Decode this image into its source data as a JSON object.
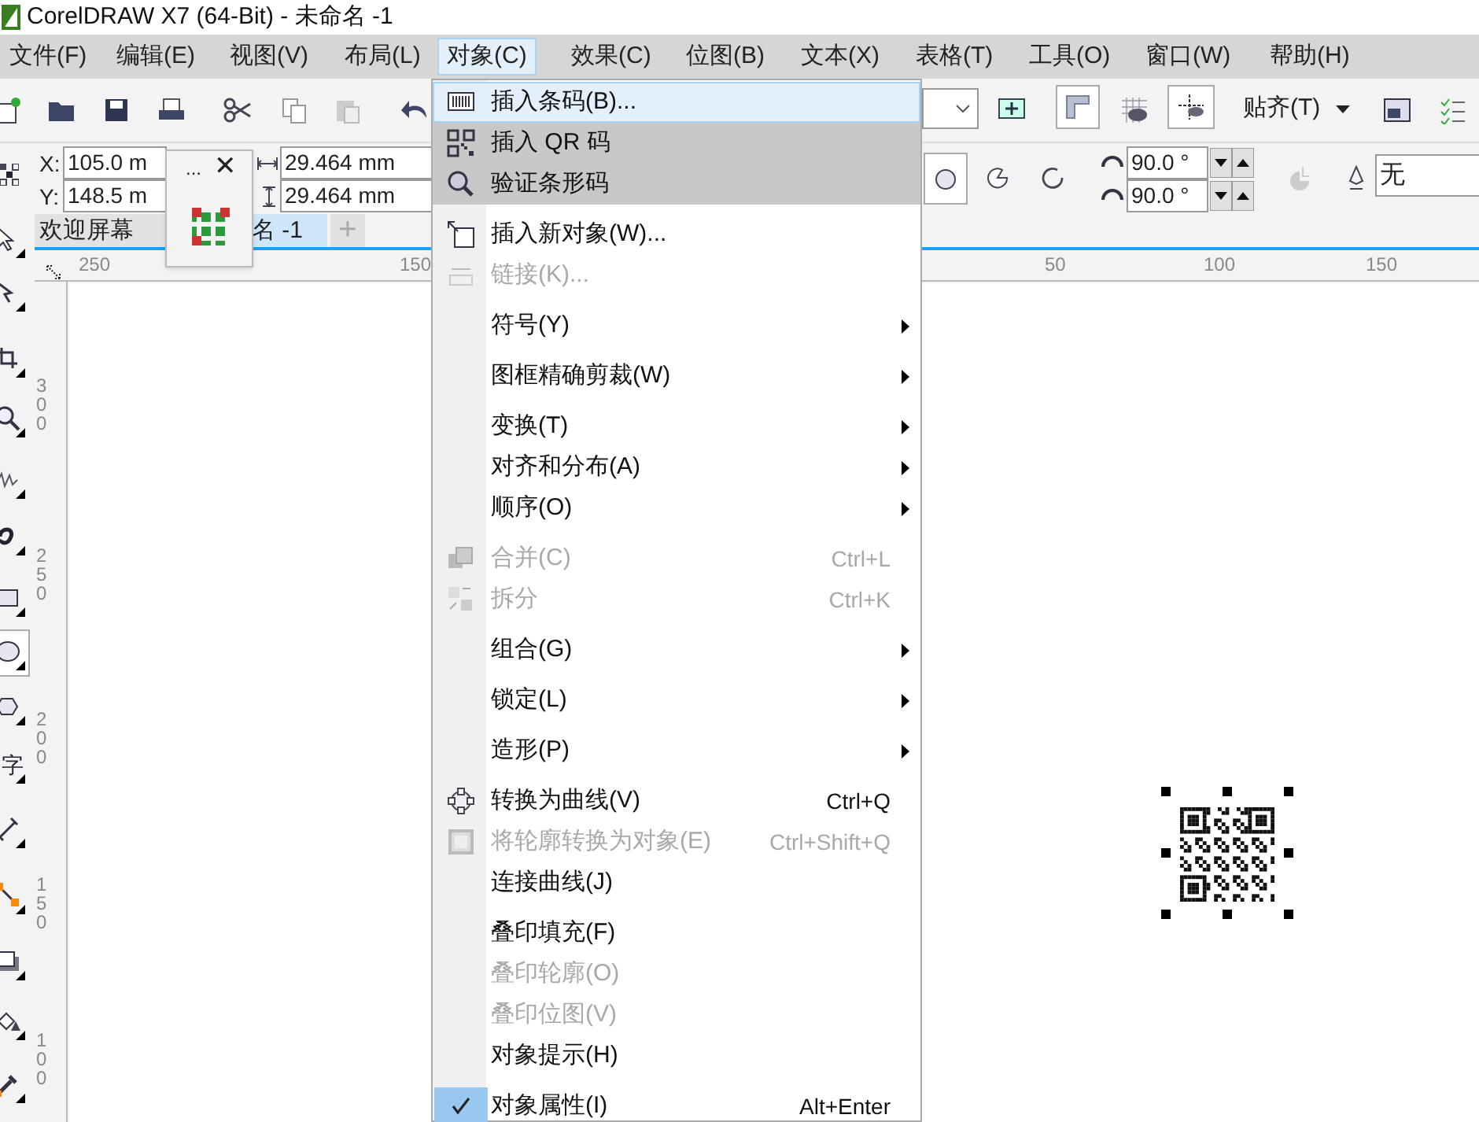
{
  "window": {
    "title": "CorelDRAW X7 (64-Bit) - 未命名 -1"
  },
  "menu_bar": [
    {
      "label": "文件(F)",
      "selected": false
    },
    {
      "label": "编辑(E)",
      "selected": false
    },
    {
      "label": "视图(V)",
      "selected": false
    },
    {
      "label": "布局(L)",
      "selected": false
    },
    {
      "label": "对象(C)",
      "selected": true
    },
    {
      "label": "效果(C)",
      "selected": false
    },
    {
      "label": "位图(B)",
      "selected": false
    },
    {
      "label": "文本(X)",
      "selected": false
    },
    {
      "label": "表格(T)",
      "selected": false
    },
    {
      "label": "工具(O)",
      "selected": false
    },
    {
      "label": "窗口(W)",
      "selected": false
    },
    {
      "label": "帮助(H)",
      "selected": false
    }
  ],
  "toolbar": {
    "snap_label": "贴齐(T)"
  },
  "property_bar": {
    "x_label": "X:",
    "x_value": "105.0 m",
    "y_label": "Y:",
    "y_value": "148.5 m",
    "width": "29.464 mm",
    "height": "29.464 mm",
    "start_angle": "90.0 °",
    "end_angle": "90.0 °",
    "outline": "无"
  },
  "popup": {
    "more": "...",
    "close": "✕"
  },
  "tabs": [
    {
      "label": "欢迎屏幕",
      "selected": false
    },
    {
      "label": "名 -1",
      "selected": true
    }
  ],
  "add_tab": "+",
  "toolbox": {
    "text_tool": "字"
  },
  "rulers": {
    "horizontal": [
      "250",
      "150",
      "50",
      "100",
      "150"
    ],
    "vertical": [
      "300",
      "250",
      "200",
      "150",
      "100"
    ]
  },
  "context_menu": [
    {
      "kind": "item",
      "label": "插入条码(B)...",
      "selected": true,
      "shaded": false,
      "disabled": false,
      "submenu": false
    },
    {
      "kind": "item",
      "label": "插入 QR 码",
      "selected": false,
      "shaded": true,
      "disabled": false,
      "submenu": false
    },
    {
      "kind": "item",
      "label": "验证条形码",
      "selected": false,
      "shaded": true,
      "disabled": false,
      "submenu": false
    },
    {
      "kind": "separator"
    },
    {
      "kind": "item",
      "label": "插入新对象(W)...",
      "selected": false,
      "shaded": false,
      "disabled": false,
      "submenu": false
    },
    {
      "kind": "item",
      "label": "链接(K)...",
      "selected": false,
      "shaded": false,
      "disabled": true,
      "submenu": false
    },
    {
      "kind": "separator"
    },
    {
      "kind": "item",
      "label": "符号(Y)",
      "selected": false,
      "shaded": false,
      "disabled": false,
      "submenu": true
    },
    {
      "kind": "separator"
    },
    {
      "kind": "item",
      "label": "图框精确剪裁(W)",
      "selected": false,
      "shaded": false,
      "disabled": false,
      "submenu": true
    },
    {
      "kind": "separator"
    },
    {
      "kind": "item",
      "label": "变换(T)",
      "selected": false,
      "shaded": false,
      "disabled": false,
      "submenu": true
    },
    {
      "kind": "item",
      "label": "对齐和分布(A)",
      "selected": false,
      "shaded": false,
      "disabled": false,
      "submenu": true
    },
    {
      "kind": "item",
      "label": "顺序(O)",
      "selected": false,
      "shaded": false,
      "disabled": false,
      "submenu": true
    },
    {
      "kind": "separator"
    },
    {
      "kind": "item",
      "label": "合并(C)",
      "shortcut": "Ctrl+L",
      "selected": false,
      "shaded": false,
      "disabled": true,
      "submenu": false
    },
    {
      "kind": "item",
      "label": "拆分",
      "shortcut": "Ctrl+K",
      "selected": false,
      "shaded": false,
      "disabled": true,
      "submenu": false
    },
    {
      "kind": "separator"
    },
    {
      "kind": "item",
      "label": "组合(G)",
      "selected": false,
      "shaded": false,
      "disabled": false,
      "submenu": true
    },
    {
      "kind": "separator"
    },
    {
      "kind": "item",
      "label": "锁定(L)",
      "selected": false,
      "shaded": false,
      "disabled": false,
      "submenu": true
    },
    {
      "kind": "separator"
    },
    {
      "kind": "item",
      "label": "造形(P)",
      "selected": false,
      "shaded": false,
      "disabled": false,
      "submenu": true
    },
    {
      "kind": "separator"
    },
    {
      "kind": "item",
      "label": "转换为曲线(V)",
      "shortcut": "Ctrl+Q",
      "selected": false,
      "shaded": false,
      "disabled": false,
      "submenu": false
    },
    {
      "kind": "item",
      "label": "将轮廓转换为对象(E)",
      "shortcut": "Ctrl+Shift+Q",
      "selected": false,
      "shaded": false,
      "disabled": true,
      "submenu": false
    },
    {
      "kind": "item",
      "label": "连接曲线(J)",
      "selected": false,
      "shaded": false,
      "disabled": false,
      "submenu": false
    },
    {
      "kind": "separator"
    },
    {
      "kind": "item",
      "label": "叠印填充(F)",
      "selected": false,
      "shaded": false,
      "disabled": false,
      "submenu": false
    },
    {
      "kind": "item",
      "label": "叠印轮廓(O)",
      "selected": false,
      "shaded": false,
      "disabled": true,
      "submenu": false
    },
    {
      "kind": "item",
      "label": "叠印位图(V)",
      "selected": false,
      "shaded": false,
      "disabled": true,
      "submenu": false
    },
    {
      "kind": "item",
      "label": "对象提示(H)",
      "selected": false,
      "shaded": false,
      "disabled": false,
      "submenu": false
    },
    {
      "kind": "separator"
    },
    {
      "kind": "item",
      "label": "对象属性(I)",
      "shortcut": "Alt+Enter",
      "selected": false,
      "shaded": false,
      "disabled": false,
      "submenu": false,
      "checked": true
    }
  ]
}
